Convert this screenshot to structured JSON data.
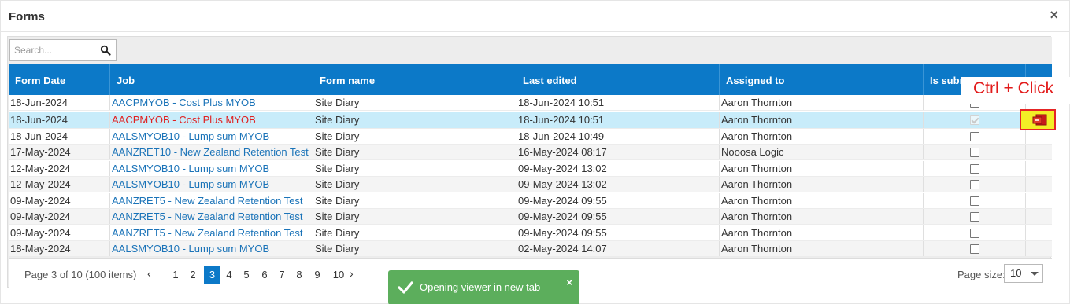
{
  "dialog": {
    "title": "Forms",
    "close_symbol": "×"
  },
  "search": {
    "placeholder": "Search...",
    "value": ""
  },
  "columns": [
    "Form Date",
    "Job",
    "Form name",
    "Last edited",
    "Assigned to",
    "Is subm"
  ],
  "rows": [
    {
      "form_date": "18-Jun-2024",
      "job": "AACPMYOB - Cost Plus MYOB",
      "form_name": "Site Diary",
      "last_edited": "18-Jun-2024 10:51",
      "assigned_to": "Aaron Thornton",
      "is_submitted": false
    },
    {
      "form_date": "18-Jun-2024",
      "job": "AACPMYOB - Cost Plus MYOB",
      "form_name": "Site Diary",
      "last_edited": "18-Jun-2024 10:51",
      "assigned_to": "Aaron Thornton",
      "is_submitted": true,
      "selected": true
    },
    {
      "form_date": "18-Jun-2024",
      "job": "AALSMYOB10 - Lump sum MYOB",
      "form_name": "Site Diary",
      "last_edited": "18-Jun-2024 10:49",
      "assigned_to": "Aaron Thornton",
      "is_submitted": false
    },
    {
      "form_date": "17-May-2024",
      "job": "AANZRET10 - New Zealand Retention Test",
      "form_name": "Site Diary",
      "last_edited": "16-May-2024 08:17",
      "assigned_to": "Nooosa Logic",
      "is_submitted": false
    },
    {
      "form_date": "12-May-2024",
      "job": "AALSMYOB10 - Lump sum MYOB",
      "form_name": "Site Diary",
      "last_edited": "09-May-2024 13:02",
      "assigned_to": "Aaron Thornton",
      "is_submitted": false
    },
    {
      "form_date": "12-May-2024",
      "job": "AALSMYOB10 - Lump sum MYOB",
      "form_name": "Site Diary",
      "last_edited": "09-May-2024 13:02",
      "assigned_to": "Aaron Thornton",
      "is_submitted": false
    },
    {
      "form_date": "09-May-2024",
      "job": "AANZRET5 - New Zealand Retention Test",
      "form_name": "Site Diary",
      "last_edited": "09-May-2024 09:55",
      "assigned_to": "Aaron Thornton",
      "is_submitted": false
    },
    {
      "form_date": "09-May-2024",
      "job": "AANZRET5 - New Zealand Retention Test",
      "form_name": "Site Diary",
      "last_edited": "09-May-2024 09:55",
      "assigned_to": "Aaron Thornton",
      "is_submitted": false
    },
    {
      "form_date": "09-May-2024",
      "job": "AANZRET5 - New Zealand Retention Test",
      "form_name": "Site Diary",
      "last_edited": "09-May-2024 09:55",
      "assigned_to": "Aaron Thornton",
      "is_submitted": false
    },
    {
      "form_date": "18-May-2024",
      "job": "AALSMYOB10 - Lump sum MYOB",
      "form_name": "Site Diary",
      "last_edited": "02-May-2024 14:07",
      "assigned_to": "Aaron Thornton",
      "is_submitted": false
    }
  ],
  "pager": {
    "info": "Page 3 of 10 (100 items)",
    "pages": [
      "1",
      "2",
      "3",
      "4",
      "5",
      "6",
      "7",
      "8",
      "9",
      "10"
    ],
    "current_page": "3",
    "prev_symbol": "‹",
    "next_symbol": "›",
    "page_size_label": "Page size:",
    "page_size": "10"
  },
  "annotation": {
    "text": "Ctrl + Click",
    "color": "#e21b1b"
  },
  "toast": {
    "text": "Opening viewer in new tab",
    "close_symbol": "×",
    "color": "#5cae5c"
  },
  "colors": {
    "header": "#0c79c8",
    "selected_row": "#c8ecfa",
    "link": "#1a73b8",
    "selected_link": "#e02020"
  }
}
